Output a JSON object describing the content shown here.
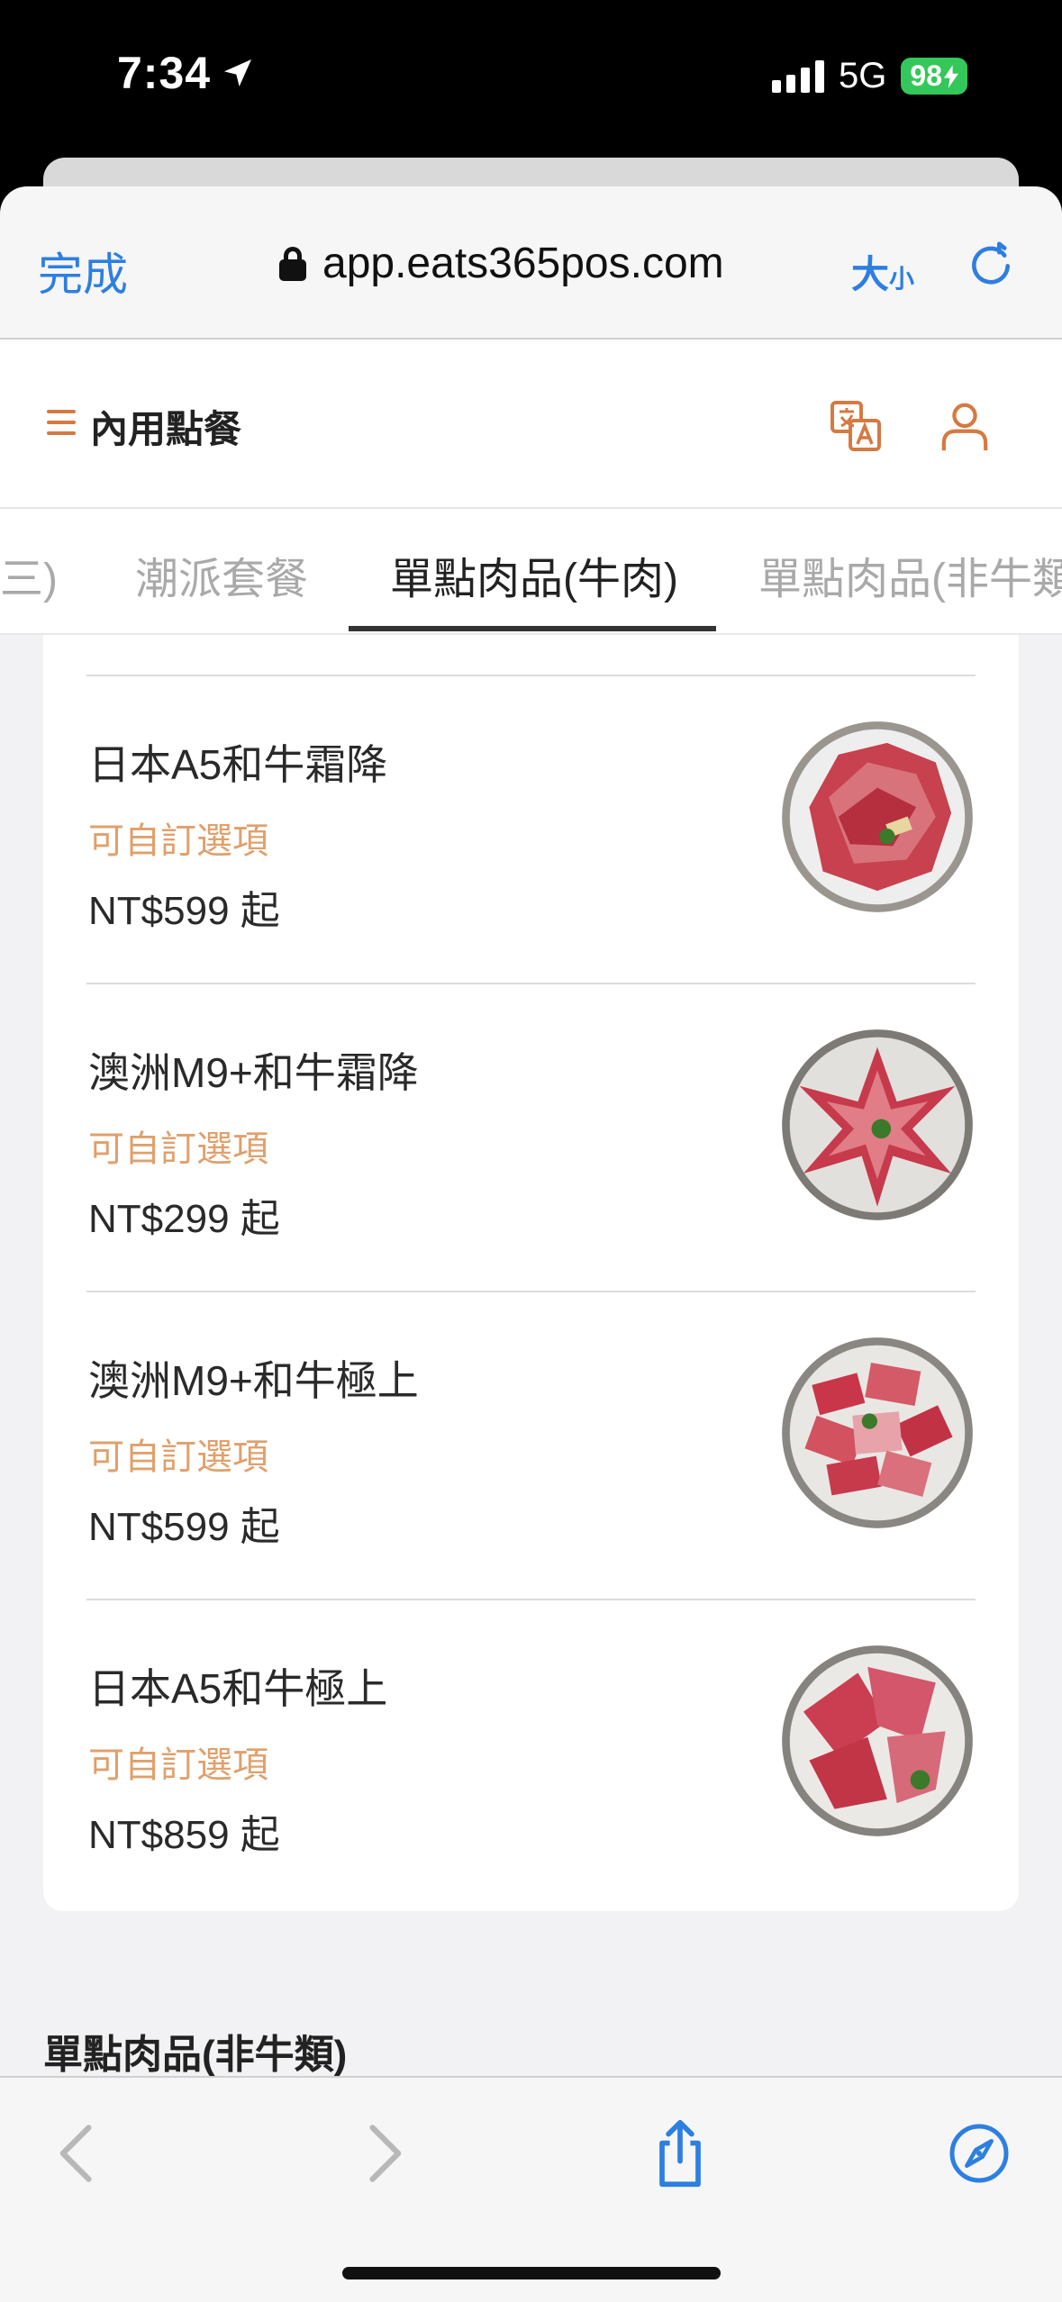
{
  "status_bar": {
    "time": "7:34",
    "network": "5G",
    "battery": "98"
  },
  "safari": {
    "done_label": "完成",
    "url": "app.eats365pos.com",
    "text_size_big": "大",
    "text_size_small": "小"
  },
  "app": {
    "title": "內用點餐"
  },
  "tabs": [
    {
      "label": "三)"
    },
    {
      "label": "潮派套餐"
    },
    {
      "label": "單點肉品(牛肉)"
    },
    {
      "label": "單點肉品(非牛類"
    }
  ],
  "active_tab": "單點肉品(牛肉)",
  "items": [
    {
      "name": "日本A5和牛霜降",
      "custom": "可自訂選項",
      "price": "NT$599 起"
    },
    {
      "name": "澳洲M9+和牛霜降",
      "custom": "可自訂選項",
      "price": "NT$299 起"
    },
    {
      "name": "澳洲M9+和牛極上",
      "custom": "可自訂選項",
      "price": "NT$599 起"
    },
    {
      "name": "日本A5和牛極上",
      "custom": "可自訂選項",
      "price": "NT$859 起"
    }
  ],
  "next_section": "單點肉品(非牛類)",
  "colors": {
    "link_blue": "#2d7fe0",
    "accent_orange": "#d47a42",
    "custom_option": "#e0a06c",
    "battery_green": "#34c759"
  }
}
